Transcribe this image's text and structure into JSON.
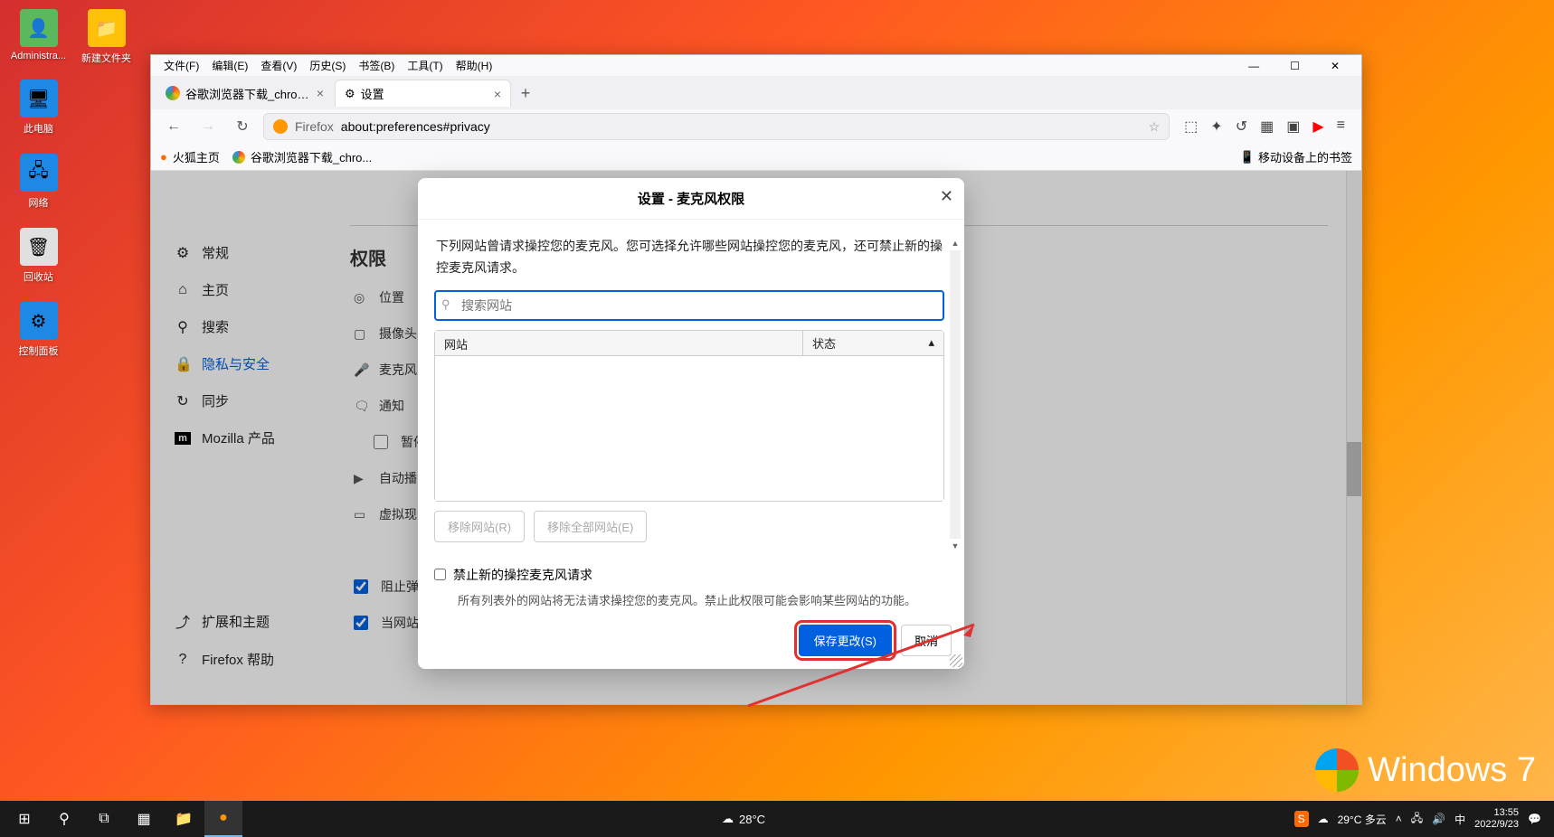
{
  "desktop": {
    "icons": [
      {
        "label": "Administra...",
        "color": "#5cb85c"
      },
      {
        "label": "新建文件夹",
        "color": "#ffc107"
      },
      {
        "label": "此电脑",
        "color": "#1e88e5"
      },
      {
        "label": "网络",
        "color": "#1e88e5"
      },
      {
        "label": "回收站",
        "color": "#e0e0e0"
      },
      {
        "label": "控制面板",
        "color": "#1e88e5"
      }
    ]
  },
  "menubar": [
    "文件(F)",
    "编辑(E)",
    "查看(V)",
    "历史(S)",
    "书签(B)",
    "工具(T)",
    "帮助(H)"
  ],
  "tabs": [
    {
      "title": "谷歌浏览器下载_chrome浏览器"
    },
    {
      "title": "设置"
    }
  ],
  "urlbar": {
    "identity": "Firefox",
    "url": "about:preferences#privacy"
  },
  "bookmarks": {
    "items": [
      "火狐主页",
      "谷歌浏览器下载_chro..."
    ],
    "right": "移动设备上的书签"
  },
  "sidebar": {
    "items": [
      {
        "icon": "⚙",
        "label": "常规"
      },
      {
        "icon": "⌂",
        "label": "主页"
      },
      {
        "icon": "⚲",
        "label": "搜索"
      },
      {
        "icon": "🔒",
        "label": "隐私与安全"
      },
      {
        "icon": "↻",
        "label": "同步"
      },
      {
        "icon": "m",
        "label": "Mozilla 产品"
      }
    ],
    "footer": [
      {
        "icon": "⤴",
        "label": "扩展和主题"
      },
      {
        "icon": "?",
        "label": "Firefox 帮助"
      }
    ]
  },
  "main": {
    "heading": "权限",
    "rows": [
      {
        "icon": "◎",
        "label": "位置"
      },
      {
        "icon": "▢",
        "label": "摄像头"
      },
      {
        "icon": "🎤",
        "label": "麦克风"
      },
      {
        "icon": "🗨",
        "label": "通知"
      },
      {
        "icon_check": true,
        "label": "暂停"
      },
      {
        "icon": "▶",
        "label": "自动播"
      },
      {
        "icon": "▭",
        "label": "虚拟现"
      }
    ],
    "checks": [
      {
        "label": "阻止弹"
      },
      {
        "label": "当网站"
      }
    ]
  },
  "modal": {
    "title": "设置 - 麦克风权限",
    "desc": "下列网站曾请求操控您的麦克风。您可选择允许哪些网站操控您的麦克风，还可禁止新的操控麦克风请求。",
    "search_placeholder": "搜索网站",
    "col_site": "网站",
    "col_status": "状态",
    "btn_remove": "移除网站(R)",
    "btn_remove_all": "移除全部网站(E)",
    "block_label": "禁止新的操控麦克风请求",
    "block_hint": "所有列表外的网站将无法请求操控您的麦克风。禁止此权限可能会影响某些网站的功能。",
    "save": "保存更改(S)",
    "cancel": "取消"
  },
  "taskbar": {
    "weather1": "28°C",
    "weather2": "29°C 多云",
    "ime": "中",
    "time": "13:55",
    "date": "2022/9/23"
  },
  "watermark": "Windows 7"
}
